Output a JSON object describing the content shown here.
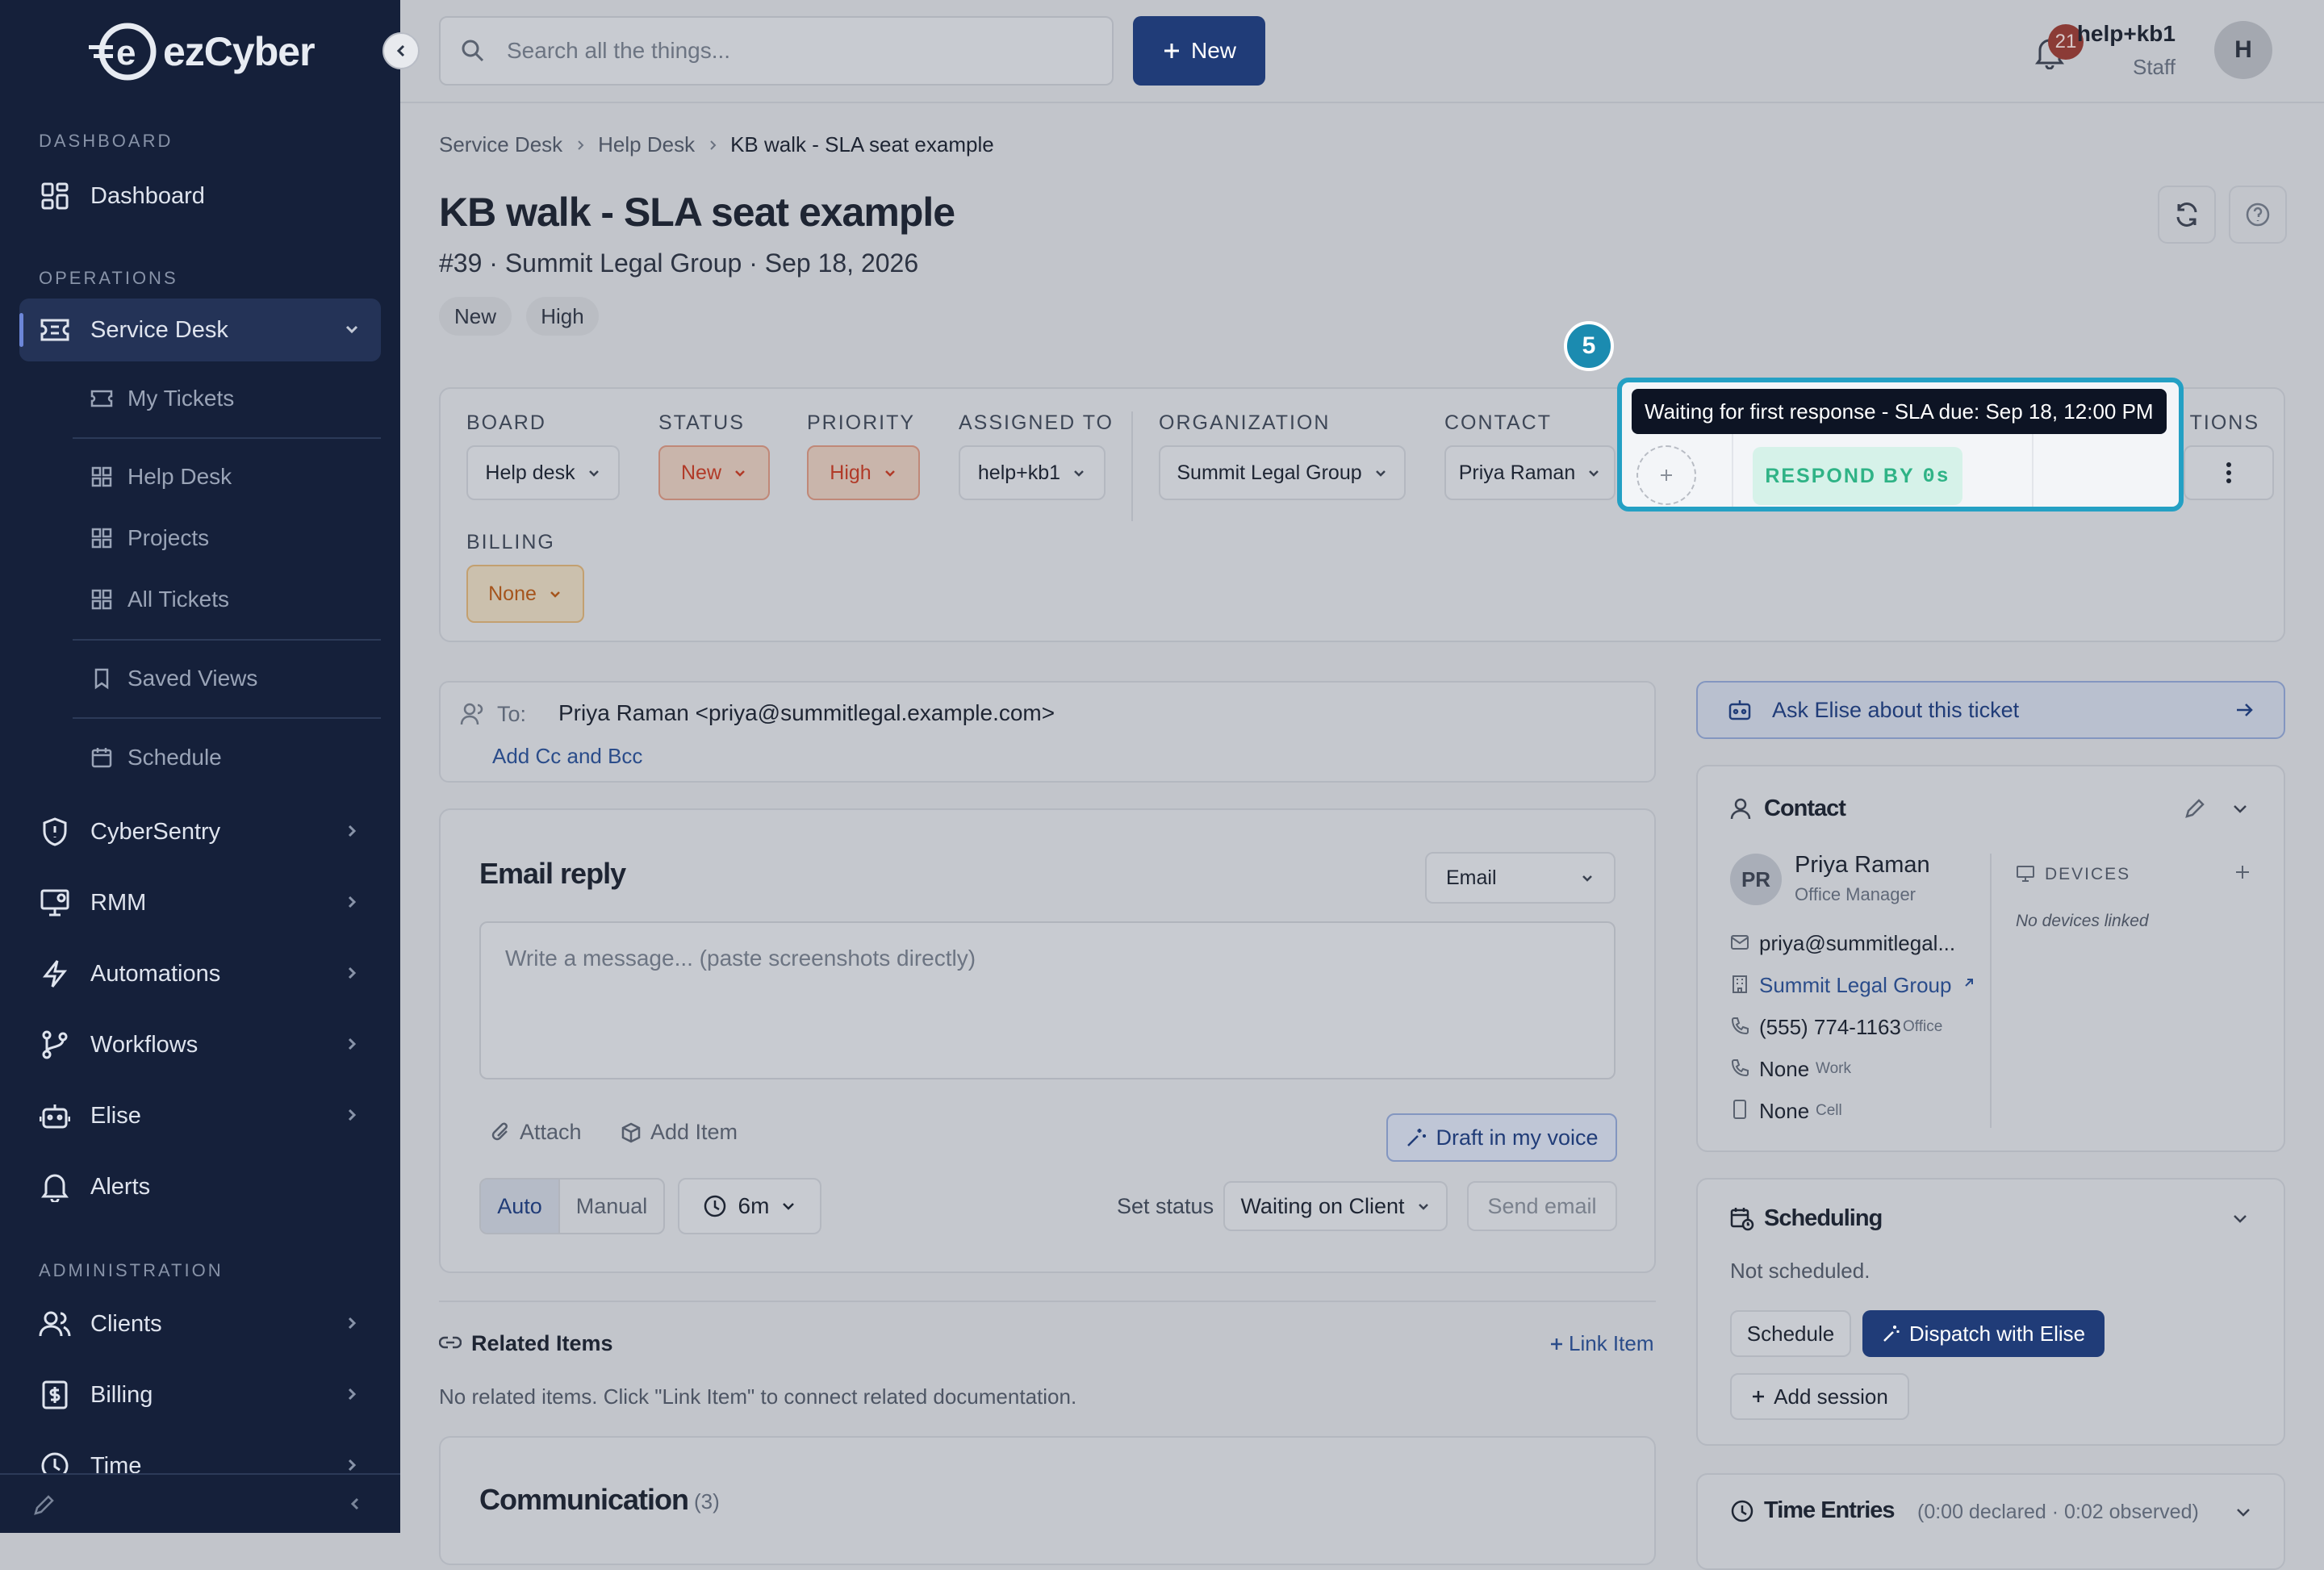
{
  "app": {
    "logo": "ezCyber"
  },
  "sidebar": {
    "sections": {
      "dashboard": "DASHBOARD",
      "operations": "OPERATIONS",
      "administration": "ADMINISTRATION"
    },
    "dashboard": "Dashboard",
    "service_desk": "Service Desk",
    "sub": {
      "my_tickets": "My Tickets",
      "help_desk": "Help Desk",
      "projects": "Projects",
      "all_tickets": "All Tickets",
      "saved_views": "Saved Views",
      "schedule": "Schedule"
    },
    "items": {
      "cybersentry": "CyberSentry",
      "rmm": "RMM",
      "automations": "Automations",
      "workflows": "Workflows",
      "elise": "Elise",
      "alerts": "Alerts",
      "clients": "Clients",
      "billing": "Billing",
      "time": "Time"
    }
  },
  "topbar": {
    "search_placeholder": "Search all the things...",
    "new_label": "New",
    "notifications": "21",
    "user_name": "help+kb1",
    "user_role": "Staff",
    "avatar": "H"
  },
  "breadcrumb": [
    "Service Desk",
    "Help Desk",
    "KB walk - SLA seat example"
  ],
  "ticket": {
    "title": "KB walk - SLA seat example",
    "subtitle": "#39 · Summit Legal Group · Sep 18, 2026",
    "tags": [
      "New",
      "High"
    ]
  },
  "fields": {
    "board": {
      "label": "BOARD",
      "value": "Help desk"
    },
    "status": {
      "label": "STATUS",
      "value": "New"
    },
    "priority": {
      "label": "PRIORITY",
      "value": "High"
    },
    "assigned": {
      "label": "ASSIGNED TO",
      "value": "help+kb1"
    },
    "organization": {
      "label": "ORGANIZATION",
      "value": "Summit Legal Group"
    },
    "contact": {
      "label": "CONTACT",
      "value": "Priya Raman"
    },
    "actions": {
      "label": "ACTIONS"
    },
    "billing": {
      "label": "BILLING",
      "value": "None"
    }
  },
  "tour": {
    "step": "5",
    "tooltip": "Waiting for first response - SLA due: Sep 18, 12:00 PM",
    "sla_label": "RESPOND BY",
    "sla_value": "0s"
  },
  "email": {
    "to_label": "To:",
    "to_value": "Priya Raman <priya@summitlegal.example.com>",
    "cc": "Add Cc and Bcc",
    "title": "Email reply",
    "channel": "Email",
    "placeholder": "Write a message... (paste screenshots directly)",
    "attach": "Attach",
    "add_item": "Add Item",
    "draft": "Draft in my voice",
    "auto": "Auto",
    "manual": "Manual",
    "timer": "6m",
    "set_status_label": "Set status",
    "set_status_value": "Waiting on Client",
    "send": "Send email"
  },
  "related": {
    "title": "Related Items",
    "link": "Link Item",
    "empty": "No related items. Click \"Link Item\" to connect related documentation."
  },
  "communication": {
    "title": "Communication",
    "count": "(3)"
  },
  "elise": {
    "ask": "Ask Elise about this ticket"
  },
  "contact_panel": {
    "title": "Contact",
    "initials": "PR",
    "name": "Priya Raman",
    "role": "Office Manager",
    "devices_label": "DEVICES",
    "no_devices": "No devices linked",
    "email": "priya@summitlegal...",
    "org": "Summit Legal Group",
    "phone": "(555) 774-1163",
    "phone_type": "Office",
    "work": "None",
    "work_type": "Work",
    "cell": "None",
    "cell_type": "Cell"
  },
  "scheduling": {
    "title": "Scheduling",
    "status": "Not scheduled.",
    "schedule": "Schedule",
    "dispatch": "Dispatch with Elise",
    "add_session": "Add session"
  },
  "time_entries": {
    "title": "Time Entries",
    "summary": "(0:00 declared · 0:02 observed)"
  }
}
